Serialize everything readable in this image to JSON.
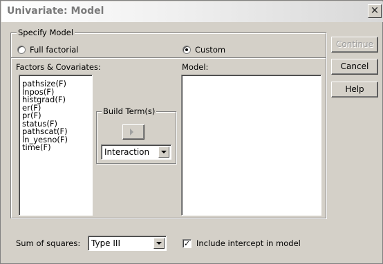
{
  "window": {
    "title": "Univariate: Model",
    "close_glyph": "✕"
  },
  "specify_model": {
    "label": "Specify Model",
    "full_factorial_label": "Full factorial",
    "custom_label": "Custom",
    "selected": "Custom"
  },
  "factors": {
    "label": "Factors & Covariates:",
    "items": [
      "pathsize(F)",
      "lnpos(F)",
      "histgrad(F)",
      "er(F)",
      "pr(F)",
      "status(F)",
      "pathscat(F)",
      "ln_yesno(F)",
      "time(F)"
    ]
  },
  "build_terms": {
    "label": "Build Term(s)",
    "type_value": "Interaction",
    "arrow_icon": "right-arrow-icon"
  },
  "model": {
    "label": "Model:",
    "items": []
  },
  "buttons": {
    "continue": "Continue",
    "cancel": "Cancel",
    "help": "Help"
  },
  "sum_of_squares": {
    "label": "Sum of squares:",
    "value": "Type III"
  },
  "intercept": {
    "label": "Include intercept in model",
    "checked": true,
    "check_glyph": "✓"
  }
}
